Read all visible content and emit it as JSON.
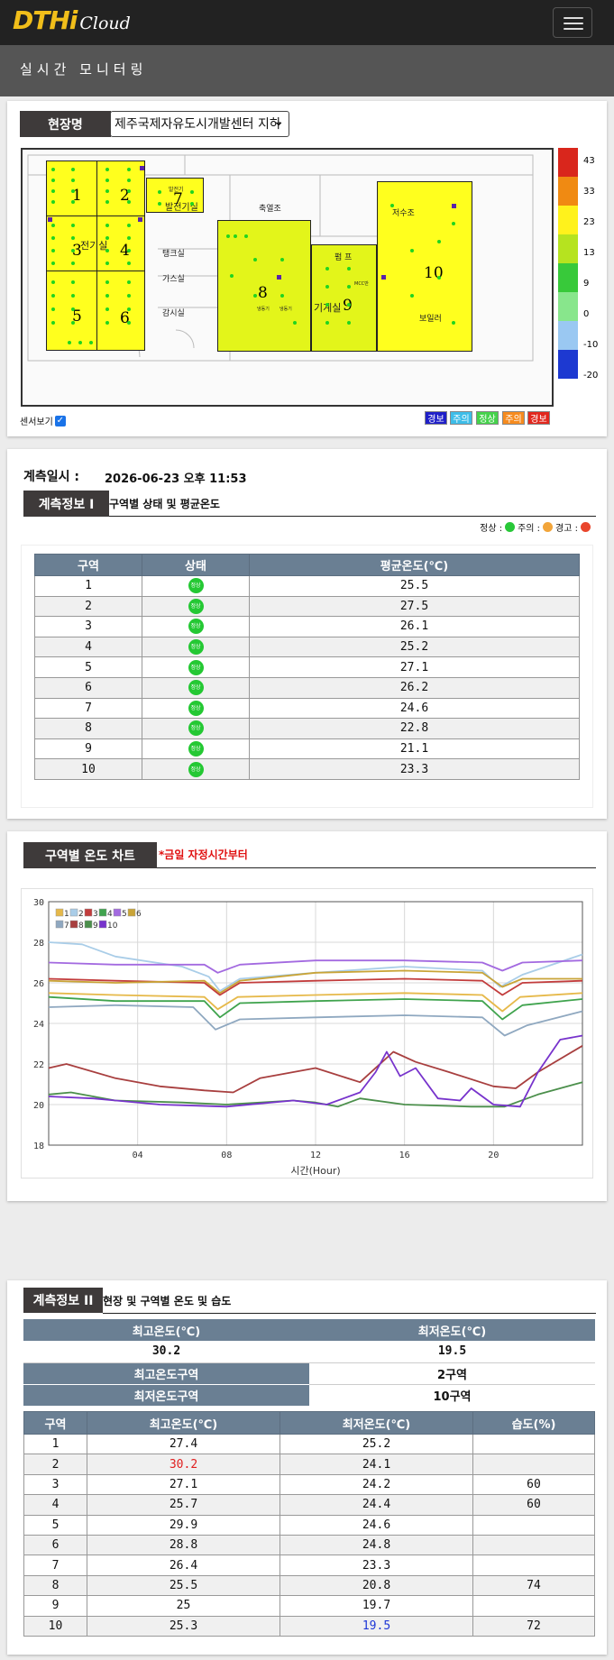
{
  "app": {
    "brand": "DTHi",
    "brand_sub": "Cloud",
    "page_title": "실시간 모니터링"
  },
  "site": {
    "label": "현장명",
    "selected": "제주국제자유도시개발센터 지하",
    "sensor_toggle": "센서보기",
    "zones": [
      {
        "id": "1"
      },
      {
        "id": "2"
      },
      {
        "id": "3"
      },
      {
        "id": "4"
      },
      {
        "id": "5"
      },
      {
        "id": "6"
      },
      {
        "id": "7"
      },
      {
        "id": "8"
      },
      {
        "id": "9"
      },
      {
        "id": "10"
      }
    ],
    "rooms": [
      "전기실",
      "발전기실",
      "발전기",
      "축열조",
      "저수조",
      "탱크실",
      "가스실",
      "감시실",
      "펌 프",
      "기계실",
      "MCC반",
      "보일러",
      "냉동기",
      "냉동기"
    ],
    "scale_labels": [
      "43",
      "33",
      "23",
      "13",
      "9",
      "0",
      "-10",
      "-20"
    ],
    "scale_colors": [
      "#d9261c",
      "#f08a12",
      "#fff21c",
      "#b6e31f",
      "#38c93a",
      "#88e68c",
      "#9ac8f2",
      "#1d39d1"
    ],
    "legend": [
      {
        "label": "경보",
        "color": "#1f1fc8"
      },
      {
        "label": "주의",
        "color": "#3dbde8"
      },
      {
        "label": "정상",
        "color": "#45d24b"
      },
      {
        "label": "주의",
        "color": "#f68b1f"
      },
      {
        "label": "경보",
        "color": "#e2281e"
      }
    ]
  },
  "measure": {
    "time_label": "계측일시 :",
    "time_value": "2026-06-23 오후 11:53",
    "info1_tag": "계측정보 I",
    "info1_title": "구역별 상태 및 평균온도",
    "status_legend": {
      "normal": "정상 :",
      "caution": "주의 :",
      "warning": "경고 :"
    },
    "table_headers": [
      "구역",
      "상태",
      "평균온도(℃)"
    ],
    "status_text": "정상",
    "rows": [
      {
        "zone": "1",
        "avg": "25.5"
      },
      {
        "zone": "2",
        "avg": "27.5"
      },
      {
        "zone": "3",
        "avg": "26.1"
      },
      {
        "zone": "4",
        "avg": "25.2"
      },
      {
        "zone": "5",
        "avg": "27.1"
      },
      {
        "zone": "6",
        "avg": "26.2"
      },
      {
        "zone": "7",
        "avg": "24.6"
      },
      {
        "zone": "8",
        "avg": "22.8"
      },
      {
        "zone": "9",
        "avg": "21.1"
      },
      {
        "zone": "10",
        "avg": "23.3"
      }
    ]
  },
  "chart_section": {
    "tag": "구역별 온도 차트",
    "note": "*금일 자정시간부터"
  },
  "chart_data": {
    "type": "line",
    "xlabel": "시간(Hour)",
    "ylabel": "",
    "xlim": [
      0,
      24
    ],
    "ylim": [
      18,
      30
    ],
    "x_ticks": [
      "04",
      "08",
      "12",
      "16",
      "20"
    ],
    "y_ticks": [
      "18",
      "20",
      "22",
      "24",
      "26",
      "28",
      "30"
    ],
    "grid": true,
    "legend_placement": "top-left",
    "series": [
      {
        "name": "1",
        "color": "#e6b94a",
        "values": [
          [
            0,
            25.5
          ],
          [
            3,
            25.4
          ],
          [
            7,
            25.3
          ],
          [
            7.6,
            24.7
          ],
          [
            8.5,
            25.3
          ],
          [
            12,
            25.4
          ],
          [
            16,
            25.5
          ],
          [
            19.5,
            25.4
          ],
          [
            20.4,
            24.6
          ],
          [
            21.2,
            25.3
          ],
          [
            24,
            25.5
          ]
        ]
      },
      {
        "name": "2",
        "color": "#a9cde8",
        "values": [
          [
            0,
            28.0
          ],
          [
            1.5,
            27.9
          ],
          [
            3,
            27.3
          ],
          [
            6,
            26.8
          ],
          [
            7.2,
            26.3
          ],
          [
            7.7,
            25.6
          ],
          [
            8.6,
            26.2
          ],
          [
            12,
            26.5
          ],
          [
            16,
            26.8
          ],
          [
            19.5,
            26.6
          ],
          [
            20.3,
            25.8
          ],
          [
            21.3,
            26.4
          ],
          [
            24,
            27.4
          ]
        ]
      },
      {
        "name": "3",
        "color": "#c23c3c",
        "values": [
          [
            0,
            26.2
          ],
          [
            3,
            26.1
          ],
          [
            7,
            26.0
          ],
          [
            7.7,
            25.4
          ],
          [
            8.6,
            26.0
          ],
          [
            12,
            26.1
          ],
          [
            16,
            26.2
          ],
          [
            19.5,
            26.1
          ],
          [
            20.4,
            25.4
          ],
          [
            21.3,
            26.0
          ],
          [
            24,
            26.1
          ]
        ]
      },
      {
        "name": "4",
        "color": "#3fa34d",
        "values": [
          [
            0,
            25.3
          ],
          [
            3,
            25.1
          ],
          [
            7,
            25.1
          ],
          [
            7.7,
            24.3
          ],
          [
            8.6,
            25.0
          ],
          [
            12,
            25.1
          ],
          [
            16,
            25.2
          ],
          [
            19.5,
            25.1
          ],
          [
            20.4,
            24.2
          ],
          [
            21.3,
            24.9
          ],
          [
            24,
            25.2
          ]
        ]
      },
      {
        "name": "5",
        "color": "#a36ae0",
        "values": [
          [
            0,
            27.0
          ],
          [
            3,
            26.9
          ],
          [
            7,
            26.9
          ],
          [
            7.6,
            26.5
          ],
          [
            8.6,
            26.9
          ],
          [
            12,
            27.1
          ],
          [
            16,
            27.1
          ],
          [
            19.5,
            27.0
          ],
          [
            20.4,
            26.6
          ],
          [
            21.3,
            27.0
          ],
          [
            24,
            27.1
          ]
        ]
      },
      {
        "name": "6",
        "color": "#c9a437",
        "values": [
          [
            0,
            26.1
          ],
          [
            3,
            26.0
          ],
          [
            7,
            26.1
          ],
          [
            7.7,
            25.5
          ],
          [
            8.6,
            26.1
          ],
          [
            12,
            26.5
          ],
          [
            16,
            26.6
          ],
          [
            19.5,
            26.5
          ],
          [
            20.4,
            25.8
          ],
          [
            21.3,
            26.2
          ],
          [
            24,
            26.2
          ]
        ]
      },
      {
        "name": "7",
        "color": "#8fa8c0",
        "values": [
          [
            0,
            24.8
          ],
          [
            3,
            24.9
          ],
          [
            6.5,
            24.8
          ],
          [
            7.5,
            23.7
          ],
          [
            8.6,
            24.2
          ],
          [
            12,
            24.3
          ],
          [
            16,
            24.4
          ],
          [
            19.5,
            24.3
          ],
          [
            20.5,
            23.4
          ],
          [
            21.5,
            23.9
          ],
          [
            24,
            24.6
          ]
        ]
      },
      {
        "name": "8",
        "color": "#a83f3f",
        "values": [
          [
            0,
            21.8
          ],
          [
            0.8,
            22.0
          ],
          [
            3,
            21.3
          ],
          [
            5,
            20.9
          ],
          [
            7,
            20.7
          ],
          [
            8.3,
            20.6
          ],
          [
            9.5,
            21.3
          ],
          [
            12,
            21.8
          ],
          [
            14,
            21.1
          ],
          [
            15.5,
            22.6
          ],
          [
            16.5,
            22.1
          ],
          [
            18,
            21.6
          ],
          [
            20,
            20.9
          ],
          [
            21,
            20.8
          ],
          [
            22,
            21.6
          ],
          [
            24,
            22.9
          ]
        ]
      },
      {
        "name": "9",
        "color": "#4b8f4b",
        "values": [
          [
            0,
            20.5
          ],
          [
            1,
            20.6
          ],
          [
            3,
            20.2
          ],
          [
            6,
            20.1
          ],
          [
            8,
            20.0
          ],
          [
            11,
            20.2
          ],
          [
            12,
            20.1
          ],
          [
            13,
            19.9
          ],
          [
            14,
            20.3
          ],
          [
            16,
            20.0
          ],
          [
            19,
            19.9
          ],
          [
            20.5,
            19.9
          ],
          [
            22,
            20.5
          ],
          [
            24,
            21.1
          ]
        ]
      },
      {
        "name": "10",
        "color": "#7733cc",
        "values": [
          [
            0,
            20.4
          ],
          [
            2,
            20.3
          ],
          [
            5,
            20.0
          ],
          [
            8,
            19.9
          ],
          [
            11,
            20.2
          ],
          [
            12.5,
            20.0
          ],
          [
            14,
            20.6
          ],
          [
            14.7,
            21.6
          ],
          [
            15.2,
            22.6
          ],
          [
            15.8,
            21.4
          ],
          [
            16.5,
            21.8
          ],
          [
            17.5,
            20.3
          ],
          [
            18.5,
            20.2
          ],
          [
            19,
            20.8
          ],
          [
            20,
            20.0
          ],
          [
            21.2,
            19.9
          ],
          [
            22,
            21.6
          ],
          [
            23,
            23.2
          ],
          [
            24,
            23.4
          ]
        ]
      }
    ]
  },
  "info2": {
    "tag": "계측정보 II",
    "title": "현장 및 구역별 온도 및 습도",
    "max_label": "최고온도(℃)",
    "min_label": "최저온도(℃)",
    "max_value": "30.2",
    "min_value": "19.5",
    "max_zone_label": "최고온도구역",
    "max_zone_value": "2구역",
    "min_zone_label": "최저온도구역",
    "min_zone_value": "10구역",
    "headers": [
      "구역",
      "최고온도(℃)",
      "최저온도(℃)",
      "습도(%)"
    ],
    "rows": [
      {
        "zone": "1",
        "max": "27.4",
        "min": "25.2",
        "hum": ""
      },
      {
        "zone": "2",
        "max": "30.2",
        "min": "24.1",
        "hum": ""
      },
      {
        "zone": "3",
        "max": "27.1",
        "min": "24.2",
        "hum": "60"
      },
      {
        "zone": "4",
        "max": "25.7",
        "min": "24.4",
        "hum": "60"
      },
      {
        "zone": "5",
        "max": "29.9",
        "min": "24.6",
        "hum": ""
      },
      {
        "zone": "6",
        "max": "28.8",
        "min": "24.8",
        "hum": ""
      },
      {
        "zone": "7",
        "max": "26.4",
        "min": "23.3",
        "hum": ""
      },
      {
        "zone": "8",
        "max": "25.5",
        "min": "20.8",
        "hum": "74"
      },
      {
        "zone": "9",
        "max": "25",
        "min": "19.7",
        "hum": ""
      },
      {
        "zone": "10",
        "max": "25.3",
        "min": "19.5",
        "hum": "72"
      }
    ]
  }
}
